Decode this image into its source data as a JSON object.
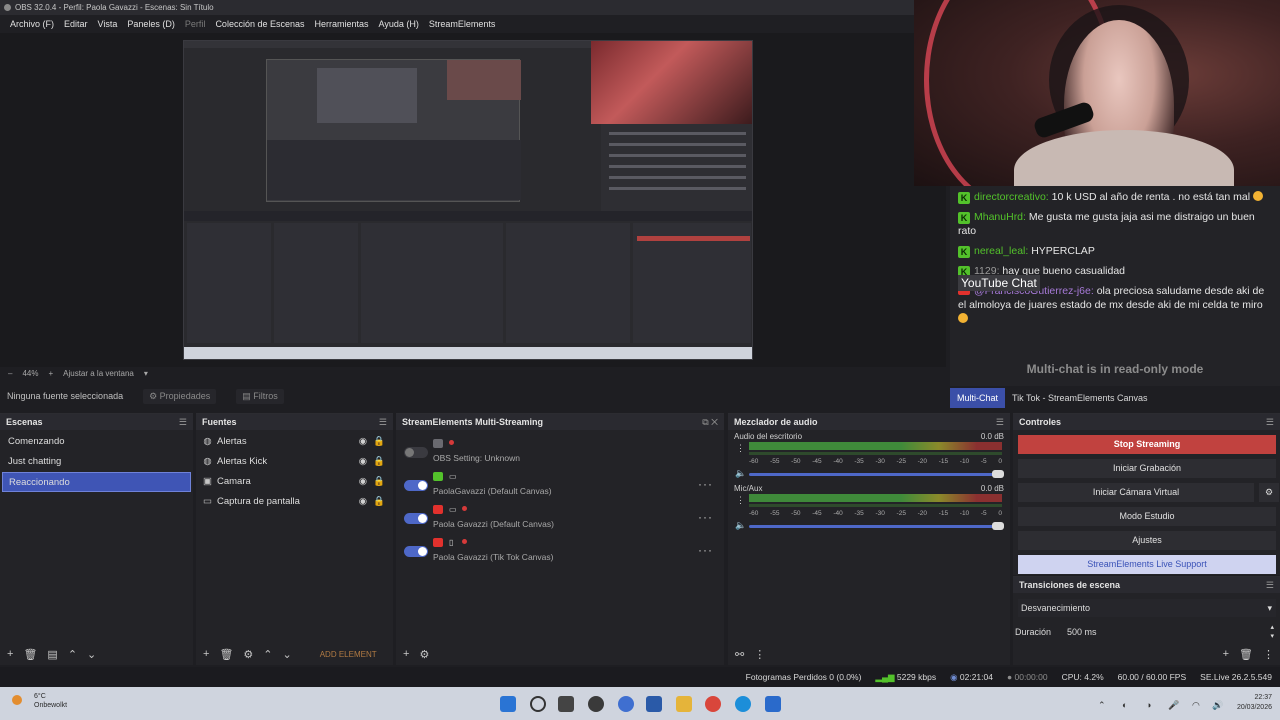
{
  "titlebar": {
    "title": "OBS 32.0.4 - Perfil: Paola Gavazzi - Escenas: Sin Título"
  },
  "menu": [
    {
      "label": "Archivo (F)",
      "dim": false
    },
    {
      "label": "Editar",
      "dim": false
    },
    {
      "label": "Vista",
      "dim": false
    },
    {
      "label": "Paneles (D)",
      "dim": false
    },
    {
      "label": "Perfil",
      "dim": true
    },
    {
      "label": "Colección de Escenas",
      "dim": false
    },
    {
      "label": "Herramientas",
      "dim": false
    },
    {
      "label": "Ayuda (H)",
      "dim": false
    },
    {
      "label": "StreamElements",
      "dim": false
    }
  ],
  "zoom": {
    "percent": "44%",
    "fit_label": "Ajustar a la ventana"
  },
  "sourcebar": {
    "selected": "Ninguna fuente seleccionada",
    "properties": "Propiedades",
    "filters": "Filtros"
  },
  "chat": {
    "messages": [
      {
        "platform": "kick",
        "user": "directorcreativo:",
        "text": " 10 k USD al año de renta . no está tan mal ",
        "emoji": true
      },
      {
        "platform": "kick",
        "user": "MhanuHrd:",
        "text": " Me gusta me gusta jaja asi me distraigo un buen rato",
        "emoji": false
      },
      {
        "platform": "kick",
        "user": "nereal_leal:",
        "text": " HYPERCLAP",
        "emoji": false
      },
      {
        "platform": "kick",
        "user": "1129:",
        "text": " hay que bueno casualidad",
        "emoji": false
      },
      {
        "platform": "youtube",
        "user": "@FranciscoGutierrez-j6e:",
        "text": " ola preciosa saludame desde aki de el almoloya de juares estado de mx desde aki de mi celda te miro ",
        "emoji": true
      }
    ],
    "tooltip": "YouTube Chat",
    "readonly": "Multi-chat is in read-only mode",
    "tabs": [
      "Multi-Chat",
      "Tik Tok - StreamElements Canvas"
    ]
  },
  "scenes": {
    "title": "Escenas",
    "items": [
      "Comenzando",
      "Just chatting",
      "Reaccionando"
    ],
    "selected_index": 2
  },
  "sources": {
    "title": "Fuentes",
    "items": [
      {
        "label": "Alertas",
        "icon": "globe-icon"
      },
      {
        "label": "Alertas Kick",
        "icon": "globe-icon"
      },
      {
        "label": "Camara",
        "icon": "camera-icon"
      },
      {
        "label": "Captura de pantalla",
        "icon": "monitor-icon"
      }
    ],
    "add_element": "ADD ELEMENT"
  },
  "multistream": {
    "title": "StreamElements Multi-Streaming",
    "rows": [
      {
        "label": "OBS Setting: Unknown",
        "on": false,
        "platform": "obs"
      },
      {
        "label": "PaolaGavazzi (Default Canvas)",
        "on": true,
        "platform": "kick"
      },
      {
        "label": "Paola Gavazzi (Default Canvas)",
        "on": true,
        "platform": "youtube"
      },
      {
        "label": "Paola Gavazzi (Tik Tok Canvas)",
        "on": true,
        "platform": "youtube"
      }
    ]
  },
  "mixer": {
    "title": "Mezclador de audio",
    "channels": [
      {
        "name": "Audio del escritorio",
        "db": "0.0 dB"
      },
      {
        "name": "Mic/Aux",
        "db": "0.0 dB"
      }
    ],
    "scale": [
      "-60",
      "-55",
      "-50",
      "-45",
      "-40",
      "-35",
      "-30",
      "-25",
      "-20",
      "-15",
      "-10",
      "-5",
      "0"
    ]
  },
  "controls": {
    "title": "Controles",
    "stop_streaming": "Stop Streaming",
    "start_recording": "Iniciar Grabación",
    "virtual_cam": "Iniciar Cámara Virtual",
    "studio_mode": "Modo Estudio",
    "settings": "Ajustes",
    "live_support": "StreamElements Live Support"
  },
  "transitions": {
    "title": "Transiciones de escena",
    "selected": "Desvanecimiento",
    "duration_label": "Duración",
    "duration_value": "500 ms"
  },
  "status": {
    "dropped": "Fotogramas Perdidos 0 (0.0%)",
    "kbps": "5229 kbps",
    "live_time": "02:21:04",
    "rec_time": "00:00:00",
    "cpu": "CPU: 4.2%",
    "fps": "60.00 / 60.00 FPS",
    "version": "SE.Live 26.2.5.549"
  },
  "taskbar": {
    "weather_temp": "6°C",
    "weather_text": "Onbewolkt",
    "time": "22:37",
    "date": "20/03/2026"
  },
  "colors": {
    "accent": "#3f55b5",
    "stop": "#c1423f",
    "kick": "#53c22b",
    "youtube": "#e2312d"
  }
}
